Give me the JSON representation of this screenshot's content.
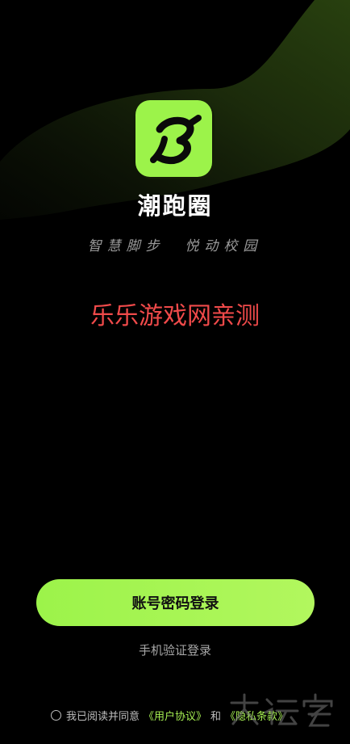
{
  "app": {
    "name": "潮跑圈",
    "slogan": "智慧脚步  悦动校园",
    "brand_color": "#a6ef52"
  },
  "overlay": {
    "watermark_text": "乐乐游戏网亲测",
    "watermark_color": "#f04a4a"
  },
  "actions": {
    "primary_label": "账号密码登录",
    "secondary_label": "手机验证登录"
  },
  "agreement": {
    "prefix": "我已阅读并同意",
    "user_agreement": "《用户协议》",
    "conjunction": "和",
    "privacy_policy": "《隐私条款》"
  },
  "icons": {
    "app_logo": "runner-logo-icon",
    "checkbox": "radio-circle-icon"
  }
}
